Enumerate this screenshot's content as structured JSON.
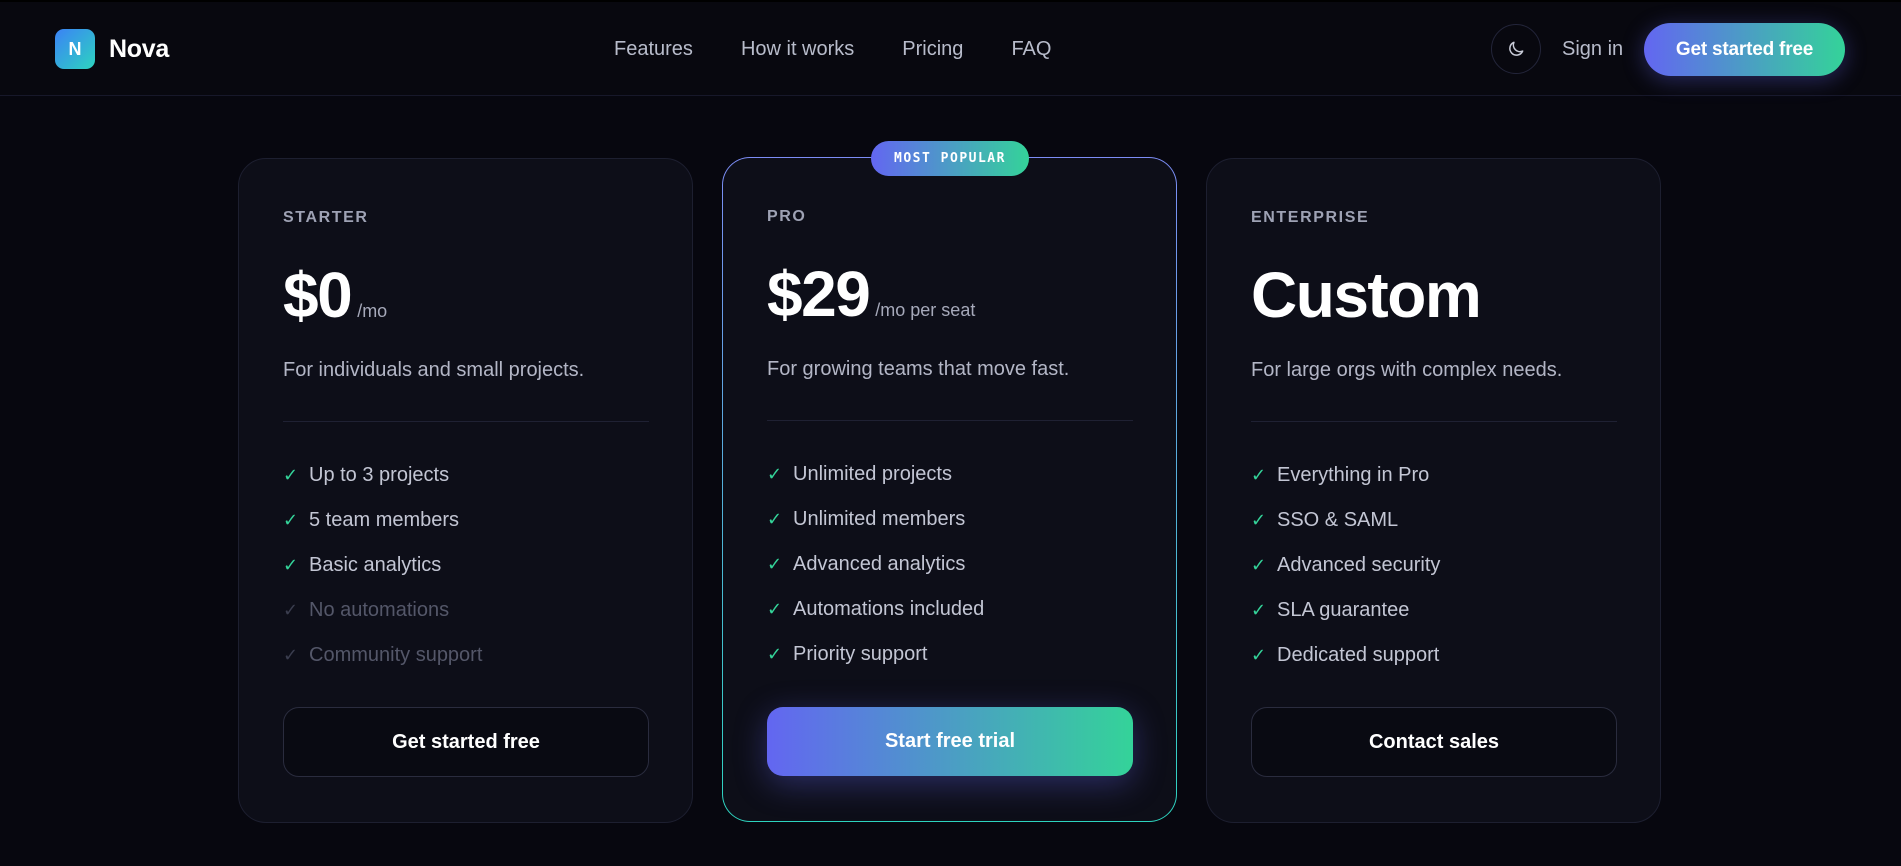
{
  "brand": {
    "logo_letter": "N",
    "name": "Nova"
  },
  "nav": {
    "items": [
      "Features",
      "How it works",
      "Pricing",
      "FAQ"
    ]
  },
  "header": {
    "theme_icon": "moon-icon",
    "signin": "Sign in",
    "cta": "Get started free"
  },
  "plans": [
    {
      "tier": "STARTER",
      "price": "$0",
      "unit": "/mo",
      "description": "For individuals and small projects.",
      "features": [
        {
          "text": "Up to 3 projects",
          "included": true
        },
        {
          "text": "5 team members",
          "included": true
        },
        {
          "text": "Basic analytics",
          "included": true
        },
        {
          "text": "No automations",
          "included": false
        },
        {
          "text": "Community support",
          "included": false
        }
      ],
      "button": "Get started free"
    },
    {
      "tier": "PRO",
      "badge": "MOST POPULAR",
      "price": "$29",
      "unit": "/mo per seat",
      "description": "For growing teams that move fast.",
      "features": [
        {
          "text": "Unlimited projects",
          "included": true
        },
        {
          "text": "Unlimited members",
          "included": true
        },
        {
          "text": "Advanced analytics",
          "included": true
        },
        {
          "text": "Automations included",
          "included": true
        },
        {
          "text": "Priority support",
          "included": true
        }
      ],
      "button": "Start free trial"
    },
    {
      "tier": "ENTERPRISE",
      "price": "Custom",
      "unit": "",
      "description": "For large orgs with complex needs.",
      "features": [
        {
          "text": "Everything in Pro",
          "included": true
        },
        {
          "text": "SSO & SAML",
          "included": true
        },
        {
          "text": "Advanced security",
          "included": true
        },
        {
          "text": "SLA guarantee",
          "included": true
        },
        {
          "text": "Dedicated support",
          "included": true
        }
      ],
      "button": "Contact sales"
    }
  ],
  "colors": {
    "accent_start": "#6366f1",
    "accent_end": "#34d399",
    "check": "#34d399",
    "background": "#07070f"
  }
}
